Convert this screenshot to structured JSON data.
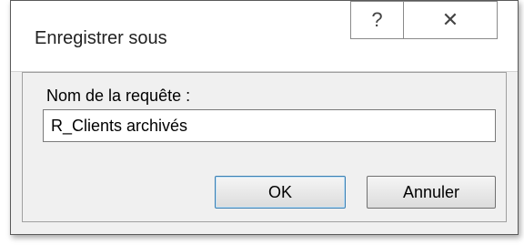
{
  "dialog": {
    "title": "Enregistrer sous",
    "help_icon": "help-icon",
    "help_glyph": "?",
    "close_icon": "close-icon",
    "close_glyph": "✕"
  },
  "form": {
    "label": "Nom de la requête :",
    "value": "R_Clients archivés"
  },
  "buttons": {
    "ok": "OK",
    "cancel": "Annuler"
  },
  "colors": {
    "default_button_border": "#3c7fb1",
    "content_background": "#f0f0f0"
  }
}
